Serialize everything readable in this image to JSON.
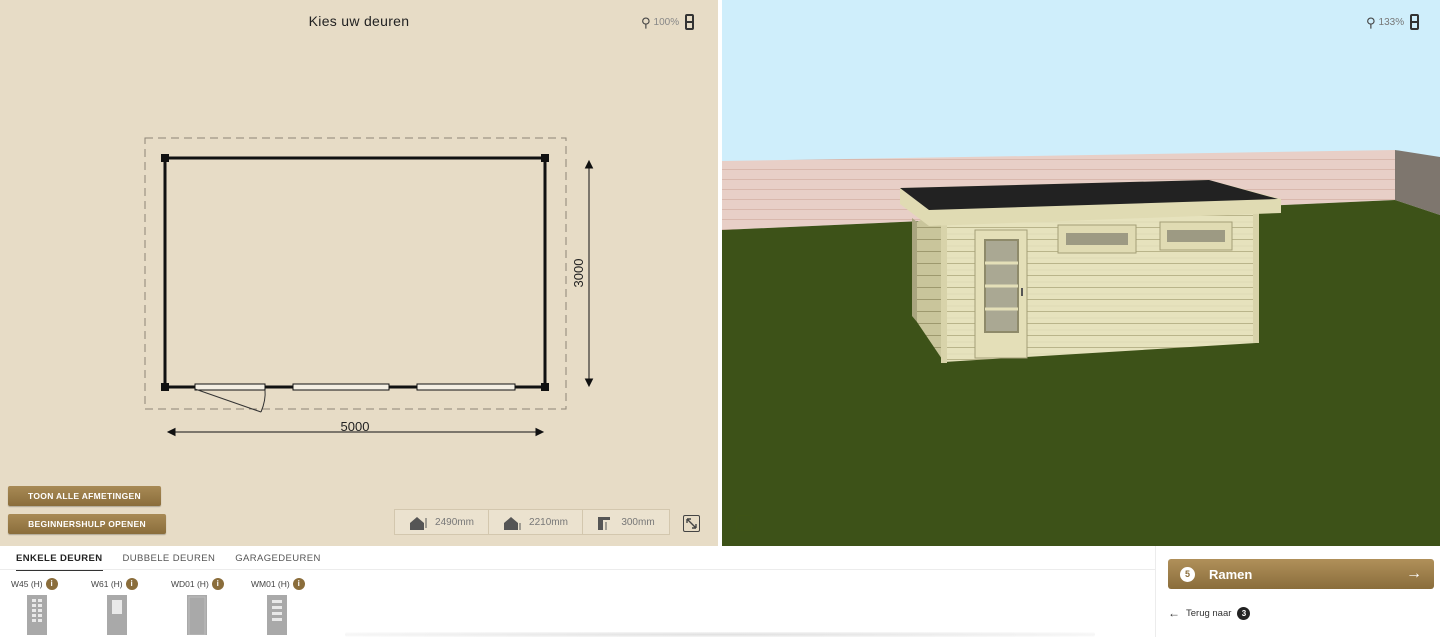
{
  "plan": {
    "title": "Kies uw deuren",
    "zoom": "100%",
    "width_label": "5000",
    "depth_label": "3000",
    "btn_show_dims": "TOON ALLE AFMETINGEN",
    "btn_beginner": "BEGINNERSHULP OPENEN",
    "measurements": [
      {
        "icon": "wall-height-icon",
        "value": "2490mm"
      },
      {
        "icon": "eave-height-icon",
        "value": "2210mm"
      },
      {
        "icon": "overhang-icon",
        "value": "300mm"
      }
    ]
  },
  "view3d": {
    "zoom": "133%",
    "colors": {
      "sky": "#cfeefb",
      "grass": "#3d5218",
      "fence": "#e8cfc7",
      "wood": "#e6e2bd",
      "roof": "#222222"
    }
  },
  "bottom": {
    "tabs": [
      "ENKELE DEUREN",
      "DUBBELE DEUREN",
      "GARAGEDEUREN"
    ],
    "active_tab": 0,
    "doors": [
      {
        "label": "W45 (H)",
        "info": "i"
      },
      {
        "label": "W61 (H)",
        "info": "i"
      },
      {
        "label": "WD01 (H)",
        "info": "i"
      },
      {
        "label": "WM01 (H)",
        "info": "i"
      }
    ],
    "next": {
      "step": "5",
      "label": "Ramen",
      "arrow": "→"
    },
    "back": {
      "arrow": "←",
      "label": "Terug naar",
      "step": "3"
    }
  }
}
